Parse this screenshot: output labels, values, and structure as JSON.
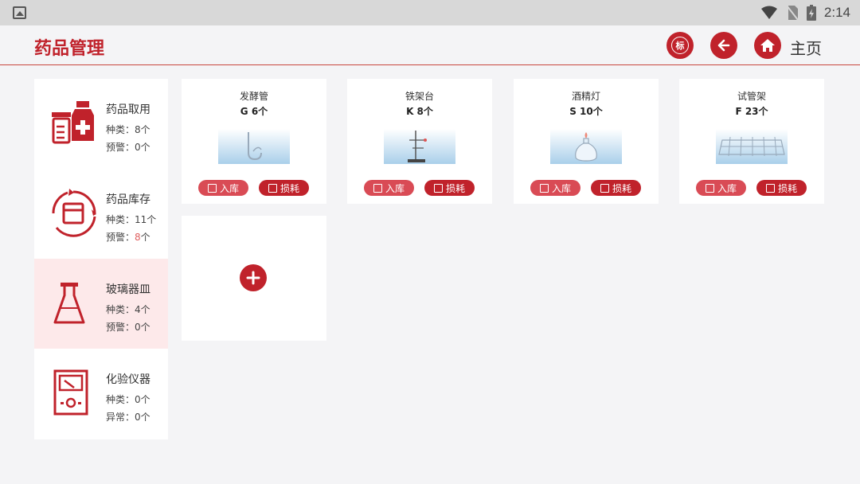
{
  "status_bar": {
    "time": "2:14"
  },
  "header": {
    "title": "药品管理",
    "tag_label": "标",
    "home_label": "主页"
  },
  "sidebar": {
    "items": [
      {
        "title": "药品取用",
        "line1_label": "种类：",
        "line1_value": "8个",
        "line2_label": "预警：",
        "line2_value": "0个",
        "icon": "medicine-bottles-icon"
      },
      {
        "title": "药品库存",
        "line1_label": "种类：",
        "line1_value": "11个",
        "line2_label": "预警：",
        "line2_value": "8",
        "line2_suffix": "个",
        "icon": "inventory-box-icon"
      },
      {
        "title": "玻璃器皿",
        "line1_label": "种类：",
        "line1_value": "4个",
        "line2_label": "预警：",
        "line2_value": "0个",
        "icon": "flask-icon"
      },
      {
        "title": "化验仪器",
        "line1_label": "种类：",
        "line1_value": "0个",
        "line2_label": "异常：",
        "line2_value": "0个",
        "icon": "meter-icon"
      }
    ]
  },
  "cards": [
    {
      "name": "发酵管",
      "count": "G 6个",
      "in_label": "入库",
      "loss_label": "损耗",
      "image": "fermentation-tube-image"
    },
    {
      "name": "铁架台",
      "count": "K 8个",
      "in_label": "入库",
      "loss_label": "损耗",
      "image": "iron-stand-image"
    },
    {
      "name": "酒精灯",
      "count": "S 10个",
      "in_label": "入库",
      "loss_label": "损耗",
      "image": "alcohol-lamp-image"
    },
    {
      "name": "试管架",
      "count": "F 23个",
      "in_label": "入库",
      "loss_label": "损耗",
      "image": "test-tube-rack-image"
    }
  ],
  "colors": {
    "accent": "#c0222b",
    "warning": "#e06060",
    "active_bg": "#fde9ea"
  }
}
